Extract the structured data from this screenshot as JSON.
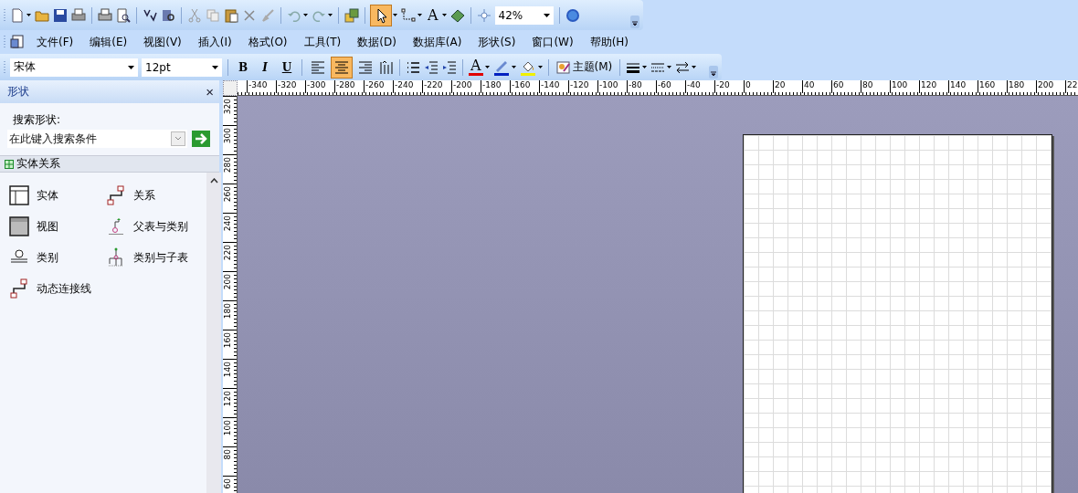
{
  "standard_toolbar": {
    "pointer_tool": {
      "selected": true
    },
    "text_tool_label": "A",
    "zoom": "42%"
  },
  "menu_bar": {
    "items": [
      "文件(F)",
      "编辑(E)",
      "视图(V)",
      "插入(I)",
      "格式(O)",
      "工具(T)",
      "数据(D)",
      "数据库(A)",
      "形状(S)",
      "窗口(W)",
      "帮助(H)"
    ]
  },
  "formatting_toolbar": {
    "font": "宋体",
    "size": "12pt",
    "style_buttons": [
      "B",
      "I",
      "U"
    ],
    "align_buttons": [
      {
        "selected": false
      },
      {
        "selected": true
      },
      {
        "selected": false
      }
    ],
    "font_color_label": "A",
    "theme_button": "主题(M)"
  },
  "shapes_panel": {
    "title": "形状",
    "close": "×",
    "search_label": "搜索形状:",
    "search_placeholder": "在此键入搜索条件",
    "stencil": "实体关系",
    "shapes": [
      "实体",
      "关系",
      "视图",
      "父表与类别",
      "类别",
      "类别与子表",
      "动态连接线"
    ]
  },
  "rulers": {
    "horizontal": [
      "-340",
      "-320",
      "-300",
      "-280",
      "-260",
      "-240",
      "-220",
      "-200",
      "-180",
      "-160",
      "-140",
      "-120",
      "-100",
      "-80",
      "-60",
      "-40",
      "-20",
      "0",
      "20",
      "40",
      "60",
      "80",
      "100",
      "120",
      "140",
      "160",
      "180",
      "200",
      "22"
    ],
    "vertical": [
      "320",
      "300",
      "280",
      "260",
      "240",
      "220",
      "200",
      "180",
      "160",
      "140",
      "120",
      "100",
      "80",
      "60"
    ]
  }
}
